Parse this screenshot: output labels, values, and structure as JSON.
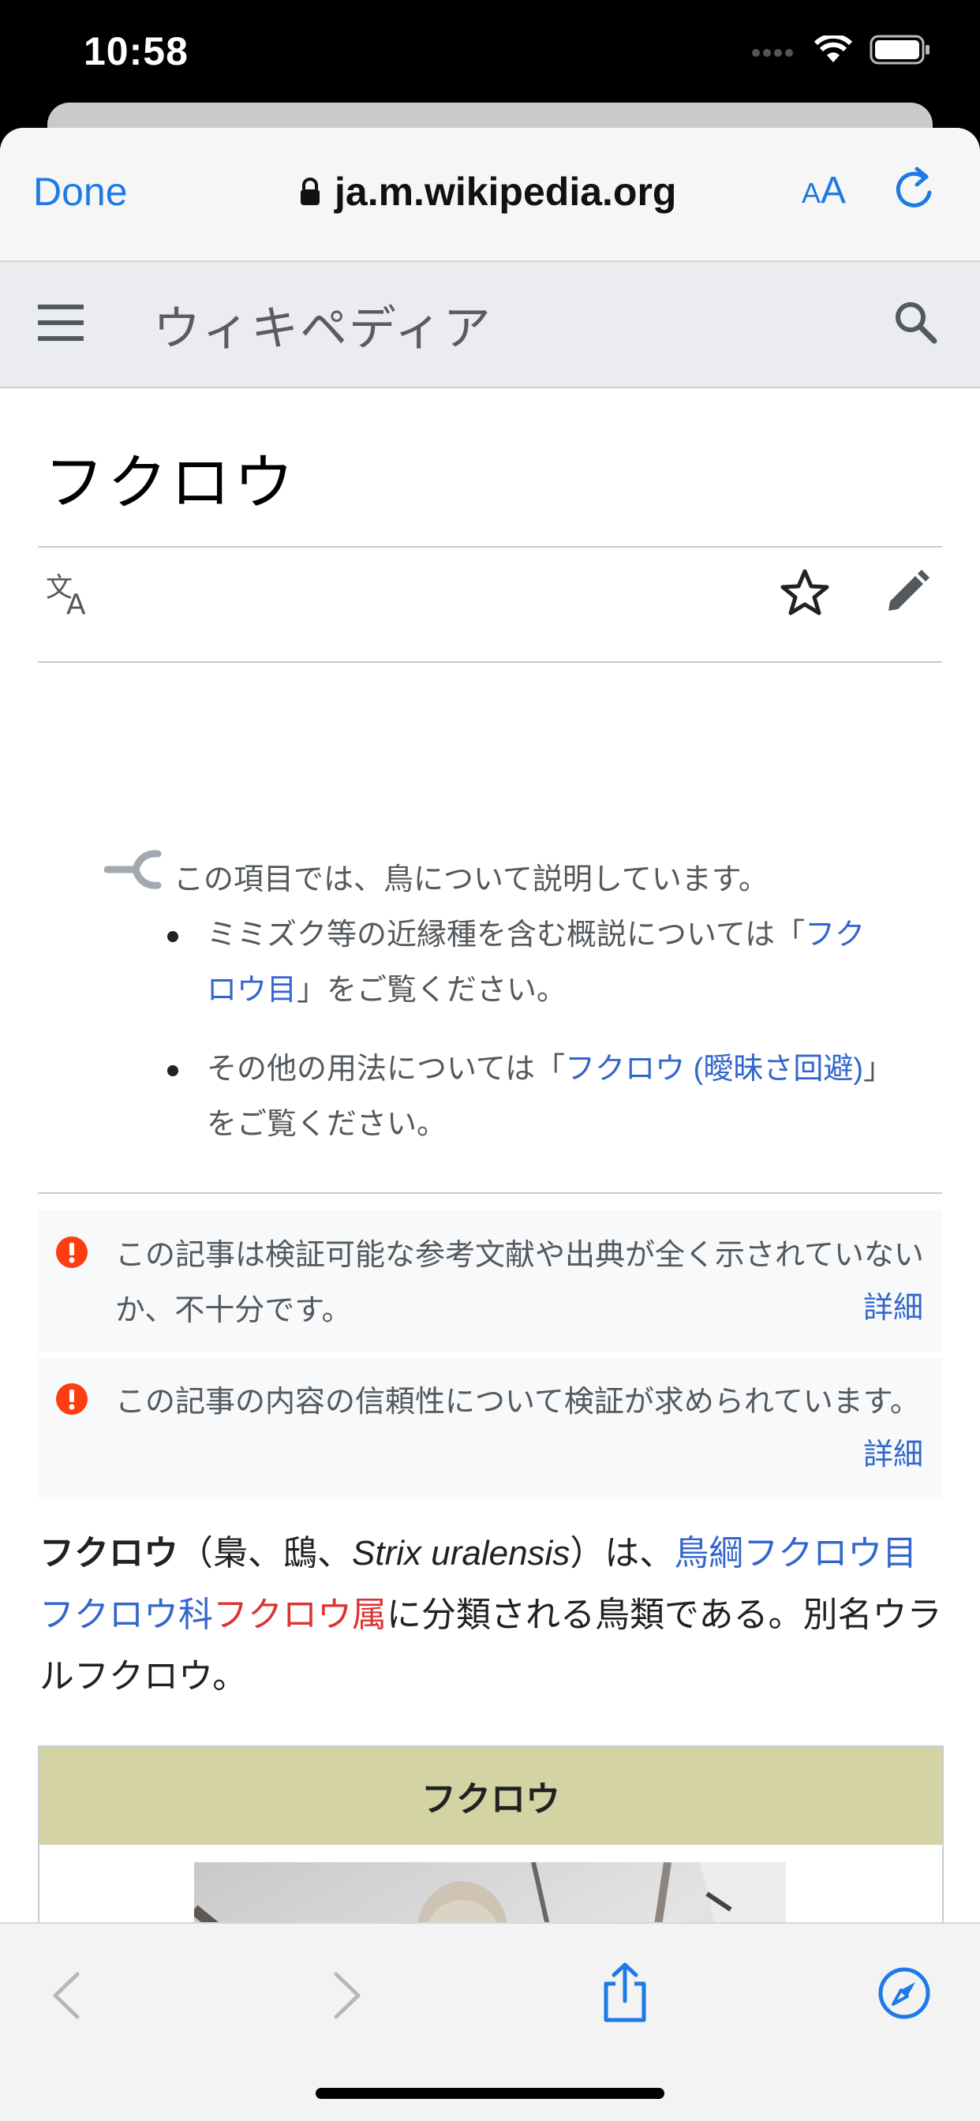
{
  "status_bar": {
    "time": "10:58"
  },
  "safari": {
    "done_label": "Done",
    "url": "ja.m.wikipedia.org",
    "text_size_label_small": "A",
    "text_size_label_big": "A"
  },
  "wiki_header": {
    "logo_text": "ウィキペディア"
  },
  "article": {
    "title": "フクロウ",
    "hatnote": {
      "intro": "この項目では、鳥について説明しています。",
      "item1_pre": "ミミズク等の近縁種を含む概説については「",
      "item1_link": "フクロウ目",
      "item1_post": "」をご覧ください。",
      "item2_pre": "その他の用法については「",
      "item2_link": "フクロウ (曖昧さ回避)",
      "item2_post": "」をご覧ください。"
    },
    "issues": [
      {
        "text": "この記事は検証可能な参考文献や出典が全く示されていないか、不十分です。",
        "more": "詳細"
      },
      {
        "text": "この記事の内容の信頼性について検証が求められています。",
        "more": "詳細"
      }
    ],
    "lead": {
      "term": "フクロウ",
      "paren_pre": "（梟、鴟、",
      "scientific": "Strix uralensis",
      "paren_post": "）は、",
      "link_class": "鳥綱",
      "link_order": "フクロウ目",
      "link_family": "フクロウ科",
      "link_genus": "フクロウ属",
      "rest": "に分類される鳥類である。別名ウラルフクロウ。"
    },
    "infobox": {
      "title": "フクロウ"
    }
  },
  "colors": {
    "link": "#3366cc",
    "redlink": "#dd3333",
    "ios_blue": "#1d7ae6",
    "infobox_header": "#d3d3a4",
    "issue_icon": "#fc3d12"
  }
}
